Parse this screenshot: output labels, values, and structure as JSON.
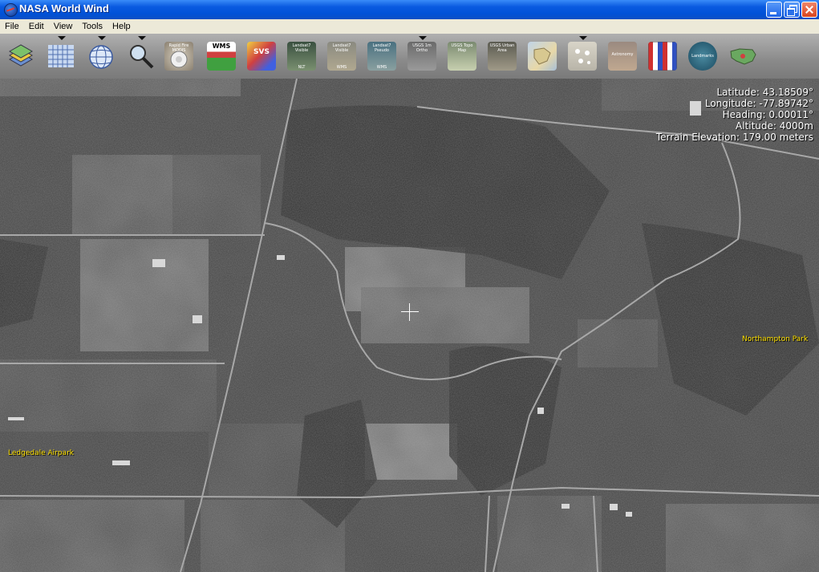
{
  "window": {
    "title": "NASA World Wind"
  },
  "menu": [
    "File",
    "Edit",
    "View",
    "Tools",
    "Help"
  ],
  "toolbar": {
    "buttons": [
      {
        "icon": "layers-icon",
        "label": ""
      },
      {
        "icon": "grid-icon",
        "label": ""
      },
      {
        "icon": "globe-icon",
        "label": ""
      },
      {
        "icon": "search-icon",
        "label": ""
      },
      {
        "icon": "rapid-fire-modis-icon",
        "label": "Rapid Fire MODIS"
      },
      {
        "icon": "wms-icon",
        "label": "WMS"
      },
      {
        "icon": "svs-icon",
        "label": "SVS"
      },
      {
        "icon": "landsat7-visible-nlt-icon",
        "label": "Landsat7 Visible",
        "sub": "NLT"
      },
      {
        "icon": "landsat7-visible-wms-icon",
        "label": "Landsat7 Visible",
        "sub": "WMS"
      },
      {
        "icon": "landsat7-pseudo-icon",
        "label": "Landsat7 Pseudo",
        "sub": "WMS"
      },
      {
        "icon": "usgs-1m-ortho-icon",
        "label": "USGS 1m Ortho"
      },
      {
        "icon": "usgs-topo-map-icon",
        "label": "USGS Topo Map"
      },
      {
        "icon": "usgs-urban-area-icon",
        "label": "USGS Urban Area"
      },
      {
        "icon": "europe-map-icon",
        "label": ""
      },
      {
        "icon": "placemark-icon",
        "label": ""
      },
      {
        "icon": "astronomy-icon",
        "label": "Astronomy"
      },
      {
        "icon": "flags-icon",
        "label": ""
      },
      {
        "icon": "landmarks-icon",
        "label": "Landmarks"
      },
      {
        "icon": "usa-map-icon",
        "label": ""
      }
    ]
  },
  "readout": {
    "latitude": "Latitude: 43.18509°",
    "longitude": "Longitude: -77.89742°",
    "heading": "Heading: 0.00011°",
    "altitude": "Altitude: 4000m",
    "terrain": "Terrain Elevation: 179.00 meters"
  },
  "placenames": {
    "northampton": "Northampton Park",
    "ledgedale": "Ledgedale Airpark"
  },
  "colors": {
    "placename": "#ffe100",
    "titlebar": "#0a5ae0",
    "menubar": "#ece9d8"
  }
}
